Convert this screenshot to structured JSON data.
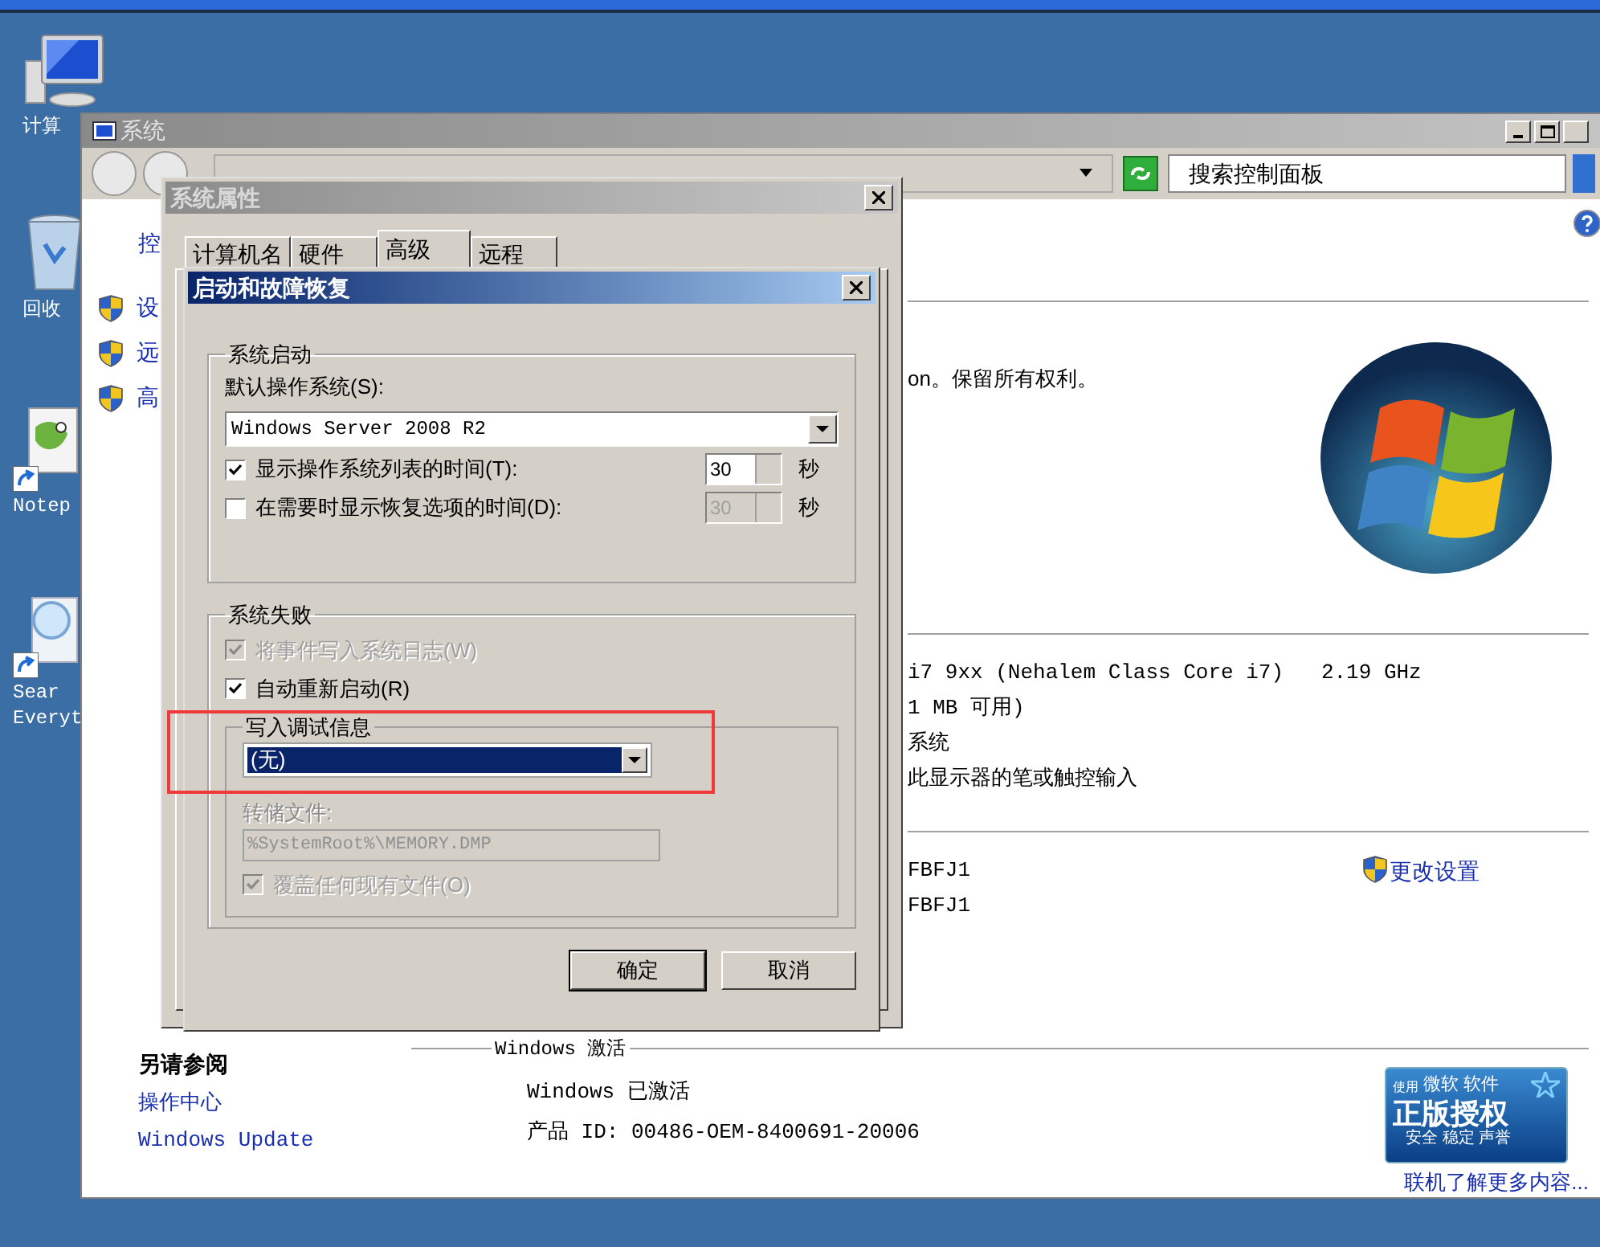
{
  "desktop": {
    "icons": [
      {
        "kind": "computer",
        "lines": [
          "计算"
        ],
        "shortcut": false
      },
      {
        "kind": "recycle-bin",
        "lines": [
          "回收"
        ],
        "shortcut": false
      },
      {
        "kind": "notepad",
        "lines": [
          "Notep"
        ],
        "shortcut": true
      },
      {
        "kind": "search",
        "lines": [
          "Sear",
          "Everyt"
        ],
        "shortcut": true
      }
    ]
  },
  "system_window": {
    "title": "系统",
    "search": {
      "placeholder": "搜索控制面板"
    },
    "left_pane": {
      "items": [
        {
          "label": "控",
          "shield": false
        },
        {
          "label": "设",
          "shield": true
        },
        {
          "label": "远",
          "shield": true
        },
        {
          "label": "高",
          "shield": true
        }
      ]
    },
    "copyright": "on。保留所有权利。",
    "system_lines": [
      "i7 9xx (Nehalem Class Core i7)   2.19 GHz",
      "1 MB 可用)",
      "系统",
      "此显示器的笔或触控输入"
    ],
    "computer_lines": [
      "FBFJ1",
      "FBFJ1"
    ],
    "change_settings": "更改设置",
    "see_also": {
      "heading": "另请参阅",
      "links": [
        "操作中心",
        "Windows Update"
      ]
    },
    "activation": {
      "heading": "Windows 激活",
      "status": "Windows 已激活",
      "product_id": "产品 ID: 00486-OEM-8400691-20006",
      "badge": {
        "small": "使用",
        "brand": "微软",
        "suffix": "软件",
        "title": "正版授权",
        "subtitle": "安全 稳定 声誉"
      },
      "link": "联机了解更多内容..."
    }
  },
  "properties_dialog": {
    "title": "系统属性",
    "tabs": [
      {
        "label": "计算机名",
        "selected": false
      },
      {
        "label": "硬件",
        "selected": false
      },
      {
        "label": "高级",
        "selected": true
      },
      {
        "label": "远程",
        "selected": false
      }
    ]
  },
  "startup_dialog": {
    "title": "启动和故障恢复",
    "startup_group": {
      "label": "系统启动",
      "os_label": "默认操作系统(S):",
      "os_value": "Windows Server 2008 R2",
      "rows": [
        {
          "label": "显示操作系统列表的时间(T):",
          "checked": true,
          "value": "30",
          "unit": "秒",
          "disabled": false
        },
        {
          "label": "在需要时显示恢复选项的时间(D):",
          "checked": false,
          "value": "30",
          "unit": "秒",
          "disabled": true
        }
      ]
    },
    "failure_group": {
      "label": "系统失败",
      "checks": [
        {
          "label": "将事件写入系统日志(W)",
          "checked": true,
          "disabled": true
        },
        {
          "label": "自动重新启动(R)",
          "checked": true,
          "disabled": false
        }
      ],
      "debug_group": {
        "label": "写入调试信息",
        "value": "(无)",
        "dump_label": "转储文件:",
        "dump_value": "%SystemRoot%\\MEMORY.DMP",
        "overwrite": {
          "label": "覆盖任何现有文件(O)",
          "checked": true,
          "disabled": true
        }
      }
    },
    "buttons": [
      "确定",
      "取消"
    ]
  },
  "annotation": {
    "kind": "highlight"
  }
}
